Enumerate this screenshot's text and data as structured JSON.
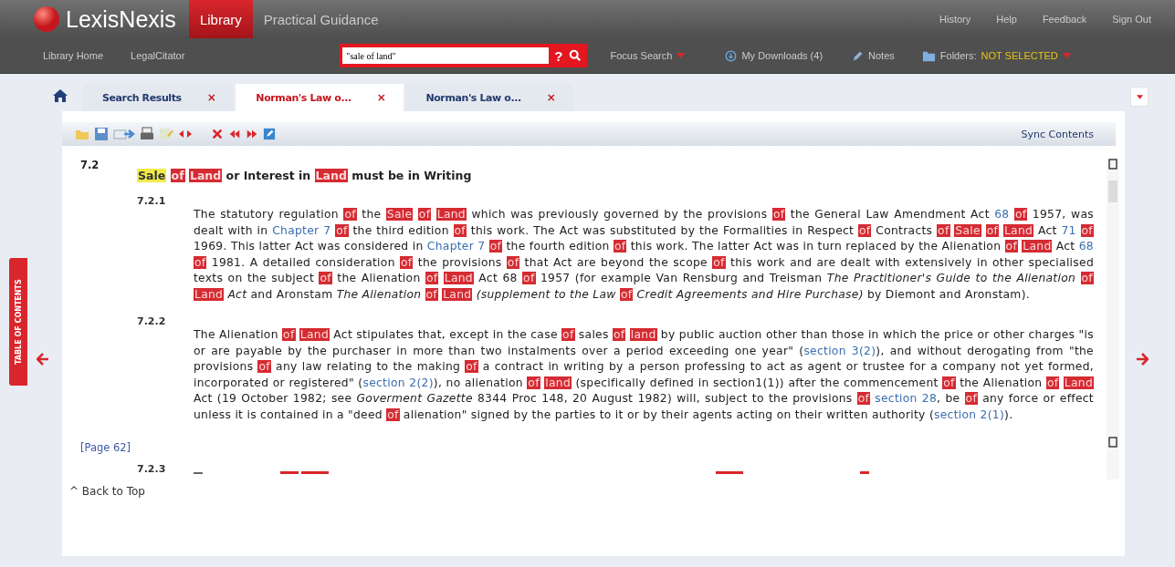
{
  "header": {
    "brand": "LexisNexis",
    "products": [
      {
        "label": "Library",
        "selected": true
      },
      {
        "label": "Practical Guidance",
        "selected": false
      }
    ],
    "utility_links": [
      "History",
      "Help",
      "Feedback",
      "Sign Out"
    ]
  },
  "nav": {
    "links": [
      "Library Home",
      "LegalCitator"
    ],
    "search": {
      "value": "\"sale of land\"",
      "help": "?"
    },
    "focus_search": "Focus Search",
    "downloads": "My Downloads (4)",
    "notes": "Notes",
    "folders_label": "Folders:",
    "folders_value": "NOT SELECTED"
  },
  "tabs": [
    {
      "label": "Search Results",
      "selected": false,
      "close": "×"
    },
    {
      "label": "Norman's Law o...",
      "selected": true,
      "close": "×"
    },
    {
      "label": "Norman's Law o...",
      "selected": false,
      "close": "×"
    }
  ],
  "side_tab": "TABLE OF CONTENTS",
  "toolbar": {
    "sync": "Sync Contents"
  },
  "document": {
    "section": {
      "number": "7.2",
      "heading": [
        {
          "kind": "mark",
          "text": "Sale "
        },
        {
          "kind": "hit",
          "text": "of "
        },
        {
          "kind": "hit",
          "text": "Land"
        },
        {
          "kind": "text",
          "text": " or Interest in "
        },
        {
          "kind": "hit",
          "text": "Land"
        },
        {
          "kind": "text",
          "text": " must be in Writing"
        }
      ]
    },
    "subsections": [
      {
        "number": "7.2.1",
        "body": [
          {
            "kind": "text",
            "text": "The statutory regulation "
          },
          {
            "kind": "hit",
            "text": "of"
          },
          {
            "kind": "text",
            "text": " the "
          },
          {
            "kind": "hit",
            "text": "Sale "
          },
          {
            "kind": "hit",
            "text": "of "
          },
          {
            "kind": "hit",
            "text": "Land"
          },
          {
            "kind": "text",
            "text": " which was previously governed by the provisions "
          },
          {
            "kind": "hit",
            "text": "of"
          },
          {
            "kind": "text",
            "text": " the General Law Amendment Act "
          },
          {
            "kind": "link",
            "text": "68 "
          },
          {
            "kind": "hit",
            "text": "of"
          },
          {
            "kind": "text",
            "text": " 1957, was dealt with in "
          },
          {
            "kind": "link",
            "text": "Chapter 7 "
          },
          {
            "kind": "hit",
            "text": "of"
          },
          {
            "kind": "text",
            "text": " the third edition "
          },
          {
            "kind": "hit",
            "text": "of"
          },
          {
            "kind": "text",
            "text": " this work. The Act was substituted by the Formalities in Respect "
          },
          {
            "kind": "hit",
            "text": "of"
          },
          {
            "kind": "text",
            "text": " Contracts "
          },
          {
            "kind": "hit",
            "text": "of "
          },
          {
            "kind": "hit",
            "text": "Sale "
          },
          {
            "kind": "hit",
            "text": "of "
          },
          {
            "kind": "hit",
            "text": "Land"
          },
          {
            "kind": "text",
            "text": " Act "
          },
          {
            "kind": "link",
            "text": "71 "
          },
          {
            "kind": "hit",
            "text": "of"
          },
          {
            "kind": "text",
            "text": " 1969. This latter Act was considered in "
          },
          {
            "kind": "link",
            "text": "Chapter 7 "
          },
          {
            "kind": "hit",
            "text": "of"
          },
          {
            "kind": "text",
            "text": " the fourth edition "
          },
          {
            "kind": "hit",
            "text": "of"
          },
          {
            "kind": "text",
            "text": " this work. The latter Act was in turn replaced by the Alienation "
          },
          {
            "kind": "hit",
            "text": "of "
          },
          {
            "kind": "hit",
            "text": "Land"
          },
          {
            "kind": "text",
            "text": " Act "
          },
          {
            "kind": "link",
            "text": "68 "
          },
          {
            "kind": "hit",
            "text": "of"
          },
          {
            "kind": "text",
            "text": " 1981. A detailed consideration "
          },
          {
            "kind": "hit",
            "text": "of"
          },
          {
            "kind": "text",
            "text": " the provisions "
          },
          {
            "kind": "hit",
            "text": "of"
          },
          {
            "kind": "text",
            "text": " that Act are beyond the scope "
          },
          {
            "kind": "hit",
            "text": "of"
          },
          {
            "kind": "text",
            "text": " this work and are dealt with extensively in other specialised texts on the subject "
          },
          {
            "kind": "hit",
            "text": "of"
          },
          {
            "kind": "text",
            "text": " the Alienation "
          },
          {
            "kind": "hit",
            "text": "of "
          },
          {
            "kind": "hit",
            "text": "Land"
          },
          {
            "kind": "text",
            "text": " Act 68 "
          },
          {
            "kind": "hit",
            "text": "of"
          },
          {
            "kind": "text",
            "text": " 1957 (for example Van Rensburg and Treisman "
          },
          {
            "kind": "em",
            "text": "The Practitioner's Guide to the Alienation "
          },
          {
            "kind": "hit",
            "text": "of "
          },
          {
            "kind": "hit",
            "text": "Land "
          },
          {
            "kind": "em",
            "text": "Act"
          },
          {
            "kind": "text",
            "text": " and Aronstam "
          },
          {
            "kind": "em",
            "text": "The Alienation "
          },
          {
            "kind": "hit",
            "text": "of "
          },
          {
            "kind": "hit",
            "text": "Land "
          },
          {
            "kind": "em",
            "text": "(supplement to the Law "
          },
          {
            "kind": "hit",
            "text": "of "
          },
          {
            "kind": "em",
            "text": "Credit Agreements and Hire Purchase)"
          },
          {
            "kind": "text",
            "text": " by Diemont and Aronstam)."
          }
        ]
      },
      {
        "number": "7.2.2",
        "body": [
          {
            "kind": "text",
            "text": "The Alienation "
          },
          {
            "kind": "hit",
            "text": "of "
          },
          {
            "kind": "hit",
            "text": "Land"
          },
          {
            "kind": "text",
            "text": " Act stipulates that, except in the case "
          },
          {
            "kind": "hit",
            "text": "of"
          },
          {
            "kind": "text",
            "text": " sales "
          },
          {
            "kind": "hit",
            "text": "of "
          },
          {
            "kind": "hit",
            "text": "land"
          },
          {
            "kind": "text",
            "text": " by public auction other than those in which the price or other charges \"is or are payable by the purchaser in more than two instalments over a period exceeding one year\" ("
          },
          {
            "kind": "link",
            "text": "section 3(2)"
          },
          {
            "kind": "text",
            "text": "), and without derogating from \"the provisions "
          },
          {
            "kind": "hit",
            "text": "of"
          },
          {
            "kind": "text",
            "text": " any law relating to the making "
          },
          {
            "kind": "hit",
            "text": "of"
          },
          {
            "kind": "text",
            "text": " a contract in writing by a person professing to act as agent or trustee for a company not yet formed, incorporated or registered\" ("
          },
          {
            "kind": "link",
            "text": "section 2(2)"
          },
          {
            "kind": "text",
            "text": "), no alienation "
          },
          {
            "kind": "hit",
            "text": "of "
          },
          {
            "kind": "hit",
            "text": "land"
          },
          {
            "kind": "text",
            "text": " (specifically defined in section1(1)) after the commencement "
          },
          {
            "kind": "hit",
            "text": "of"
          },
          {
            "kind": "text",
            "text": " the Alienation "
          },
          {
            "kind": "hit",
            "text": "of "
          },
          {
            "kind": "hit",
            "text": "Land"
          },
          {
            "kind": "text",
            "text": " Act (19 October 1982; see "
          },
          {
            "kind": "em",
            "text": "Goverment Gazette"
          },
          {
            "kind": "text",
            "text": " 8344 Proc 148, 20 August 1982) will, subject to the provisions "
          },
          {
            "kind": "hit",
            "text": "of "
          },
          {
            "kind": "link",
            "text": "section 28"
          },
          {
            "kind": "text",
            "text": ", be "
          },
          {
            "kind": "hit",
            "text": "of"
          },
          {
            "kind": "text",
            "text": " any force or effect unless it is contained in a \"deed "
          },
          {
            "kind": "hit",
            "text": "of"
          },
          {
            "kind": "text",
            "text": " alienation\" signed by the parties to it or by their agents acting on their written authority ("
          },
          {
            "kind": "link",
            "text": "section 2(1)"
          },
          {
            "kind": "text",
            "text": ")."
          }
        ]
      }
    ],
    "page_marker": "[Page 62]",
    "cut_subsection": "7.2.3"
  },
  "back_to_top": "^ Back to Top"
}
